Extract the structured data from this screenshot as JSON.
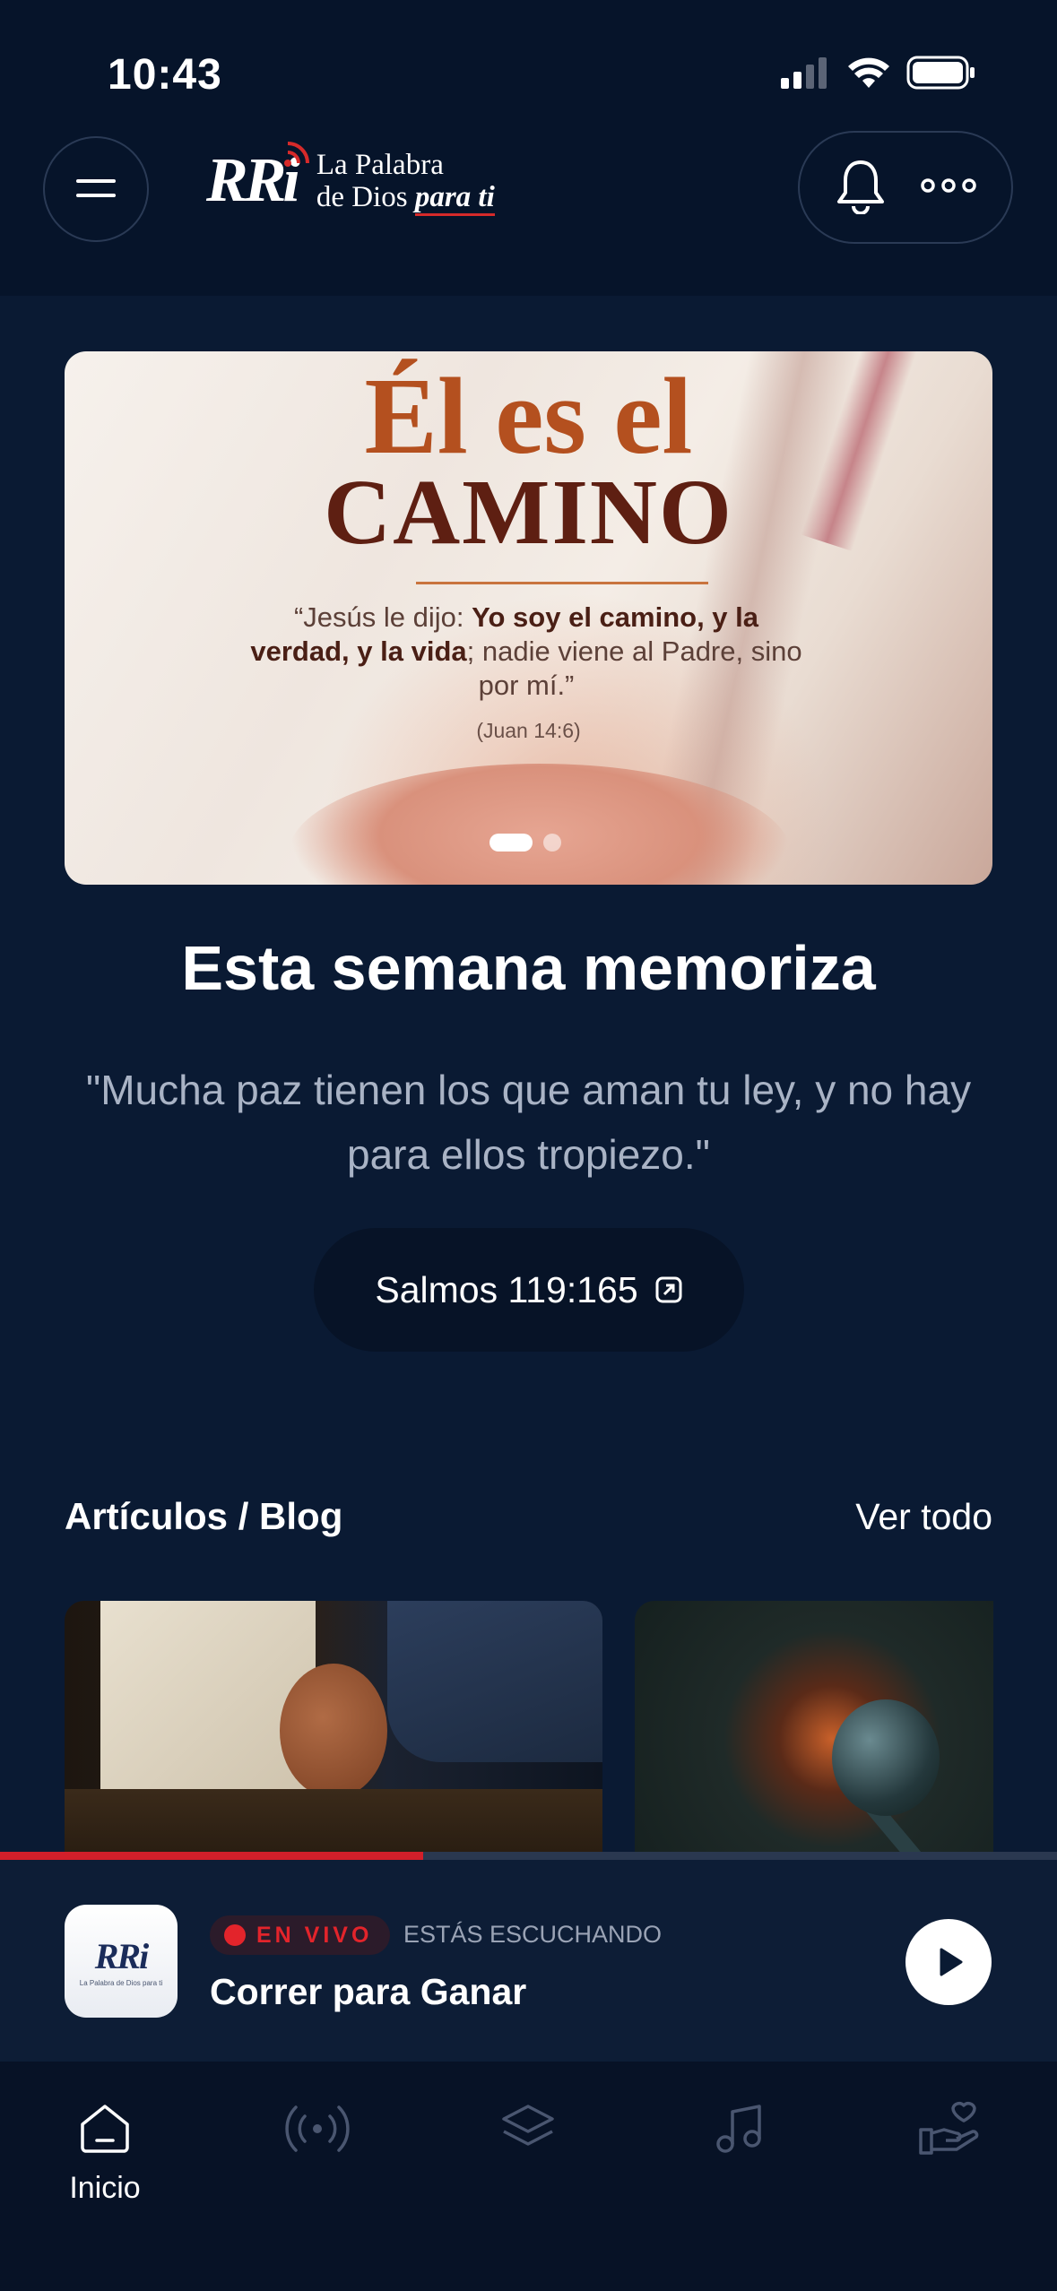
{
  "status_bar": {
    "time": "10:43"
  },
  "header": {
    "logo_mark": "RRi",
    "logo_line1": "La Palabra",
    "logo_line2_prefix": "de Dios ",
    "logo_line2_strong": "para ti"
  },
  "hero": {
    "title_line1": "Él es el",
    "title_line2": "CAMINO",
    "verse_part1": "“Jesús le dijo: ",
    "verse_bold1": "Yo soy el camino, y la verdad, y la vida",
    "verse_part2": "; nadie viene al Padre, sino por mí.”",
    "reference": "(Juan 14:6)",
    "slide_count": 2,
    "active_slide": 1
  },
  "memorize": {
    "title": "Esta semana memoriza",
    "quote": "\"Mucha paz tienen los que aman tu ley, y no hay para ellos tropiezo.\"",
    "reference": "Salmos 119:165"
  },
  "articles": {
    "title": "Artículos / Blog",
    "see_all": "Ver todo"
  },
  "player": {
    "progress_percent": 40,
    "logo_mark": "RRi",
    "logo_sub": "La Palabra de Dios para ti",
    "live_label": "EN VIVO",
    "listening_label": "ESTÁS ESCUCHANDO",
    "program_title": "Correr para Ganar"
  },
  "tabbar": {
    "items": [
      {
        "label": "Inicio",
        "icon": "home-icon",
        "active": true
      },
      {
        "label": "",
        "icon": "radio-broadcast-icon",
        "active": false
      },
      {
        "label": "",
        "icon": "layers-icon",
        "active": false
      },
      {
        "label": "",
        "icon": "music-note-icon",
        "active": false
      },
      {
        "label": "",
        "icon": "hand-heart-icon",
        "active": false
      }
    ]
  },
  "colors": {
    "background": "#0a1a33",
    "header_background": "#06142a",
    "accent_red": "#d21f2a",
    "muted_text": "#a9b3c5"
  }
}
